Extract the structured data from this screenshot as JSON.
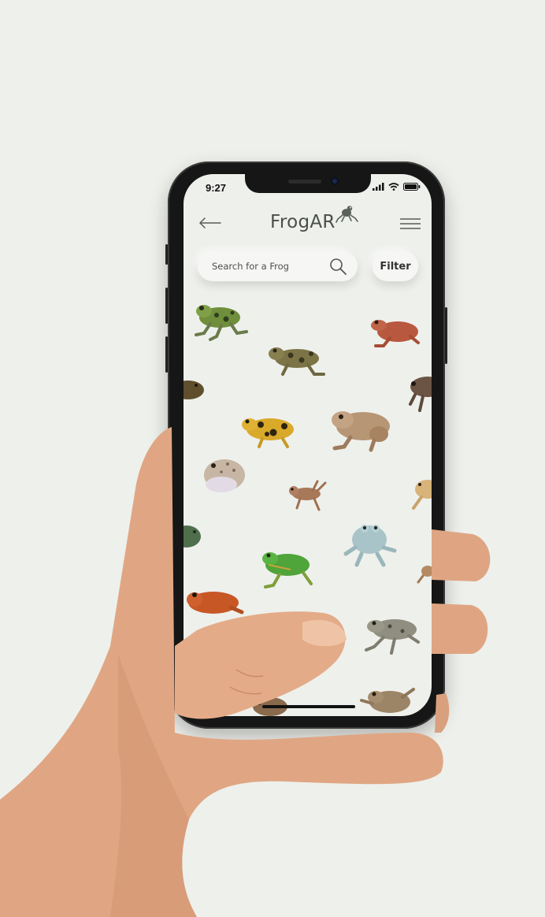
{
  "status_bar": {
    "time": "9:27"
  },
  "header": {
    "title": "FrogAR",
    "back_icon": "arrow-left-icon",
    "menu_icon": "hamburger-menu-icon",
    "logo_icon": "frog-logo-icon"
  },
  "search": {
    "placeholder": "Search for a Frog",
    "value": "",
    "icon": "magnifier-icon"
  },
  "filter": {
    "label": "Filter"
  },
  "frogs": [
    "green-spotted-frog",
    "red-brown-frog",
    "leopard-frog",
    "partial-frog-left",
    "partial-frog-right",
    "yellow-black-spotted-frog",
    "tan-toad",
    "grey-spotted-toad",
    "small-brown-frog",
    "partial-yellow-frog",
    "partial-green-frog",
    "white-tree-frog",
    "bright-green-frog",
    "red-tomato-frog",
    "grey-toad",
    "tan-frog"
  ],
  "colors": {
    "background": "#eef0ec",
    "phone_body": "#161616",
    "title_text": "#4a4f4a",
    "skin": "#e2a886"
  }
}
